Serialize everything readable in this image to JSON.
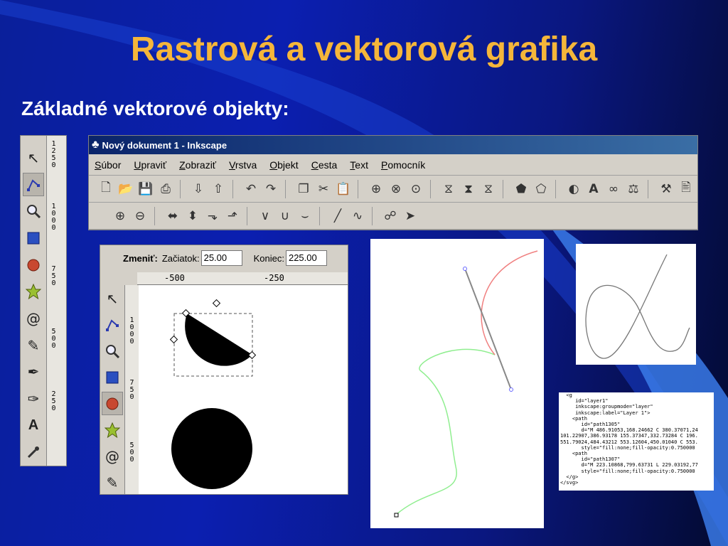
{
  "slide": {
    "title": "Rastrová a vektorová grafika",
    "subtitle": "Základné vektorové objekty:"
  },
  "colors": {
    "title": "#f5b63a",
    "background": "#0a1f9a",
    "titlebar": "#0a246a",
    "curve_green": "#90ee90",
    "curve_red": "#f08080"
  },
  "toolbox": {
    "tools": [
      {
        "icon": "selector-arrow-icon"
      },
      {
        "icon": "node-editor-icon"
      },
      {
        "icon": "zoom-icon"
      },
      {
        "icon": "rectangle-icon"
      },
      {
        "icon": "ellipse-icon"
      },
      {
        "icon": "star-icon"
      },
      {
        "icon": "spiral-icon"
      },
      {
        "icon": "pencil-icon"
      },
      {
        "icon": "pen-icon"
      },
      {
        "icon": "calligraphy-icon"
      },
      {
        "icon": "text-icon"
      },
      {
        "icon": "dropper-icon"
      }
    ],
    "ruler_labels": [
      "1250",
      "1000",
      "750",
      "500",
      "250"
    ]
  },
  "inkscape": {
    "title": "Nový dokument 1 - Inkscape",
    "menu": [
      {
        "first": "S",
        "rest": "úbor"
      },
      {
        "first": "U",
        "rest": "praviť"
      },
      {
        "first": "Z",
        "rest": "obraziť"
      },
      {
        "first": "V",
        "rest": "rstva"
      },
      {
        "first": "O",
        "rest": "bjekt"
      },
      {
        "first": "C",
        "rest": "esta"
      },
      {
        "first": "T",
        "rest": "ext"
      },
      {
        "first": "P",
        "rest": "omocník"
      }
    ]
  },
  "arc_tool": {
    "change_label": "Zmeniť:",
    "start_label": "Začiatok:",
    "start_value": "25.00",
    "end_label": "Koniec:",
    "end_value": "225.00",
    "hruler_labels": [
      "-500",
      "-250"
    ],
    "vruler_labels": [
      "1000",
      "750",
      "500"
    ]
  },
  "xml": {
    "lines": [
      "  <g",
      "     id=\"layer1\"",
      "     inkscape:groupmode=\"layer\"",
      "     inkscape:label=\"Layer 1\">",
      "    <path",
      "       id=\"path1305\"",
      "       d=\"M 486.91053,168.24662 C 380.37071,24",
      "101.22907,386.93178 155.37347,332.73284 C 196.",
      "551.79024,484.43212 553.12604,450.01040 C 553.",
      "       style=\"fill:none;fill-opacity:0.750000",
      "    <path",
      "       id=\"path1307\"",
      "       d=\"M 223.10868,799.63731 L 229.03192,77",
      "       style=\"fill:none;fill-opacity:0.750000",
      "  </g>",
      "</svg>"
    ]
  }
}
